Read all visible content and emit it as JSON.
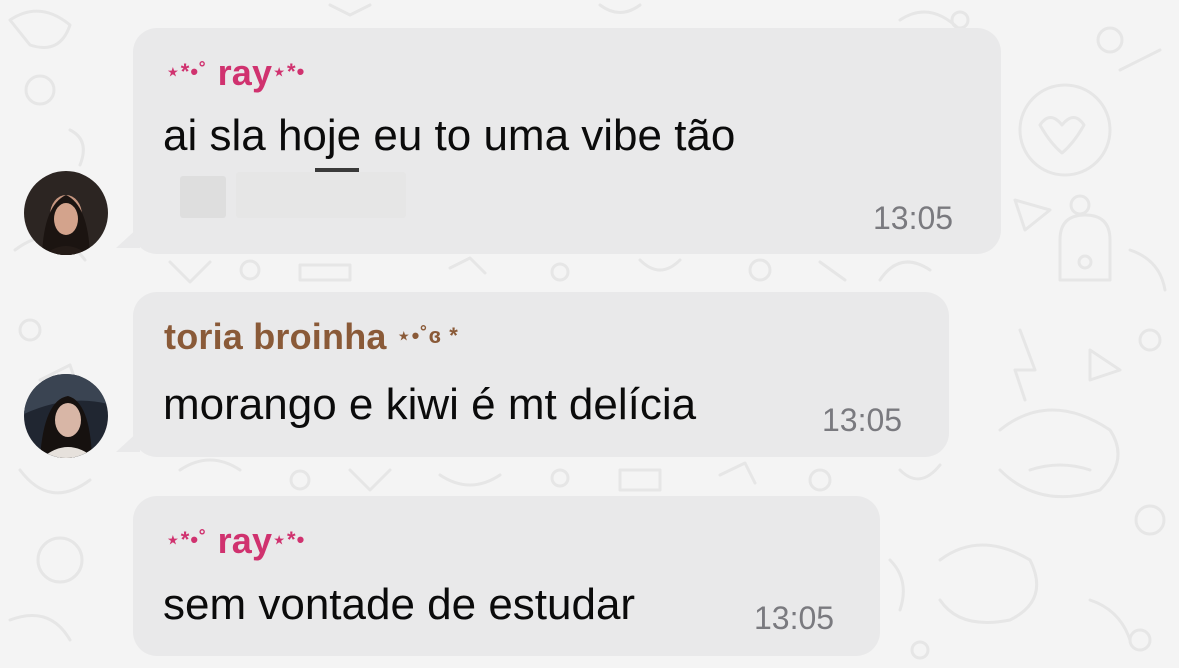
{
  "colors": {
    "background": "#f4f4f4",
    "bubble": "#e9e9ea",
    "sender_ray": "#d0326f",
    "sender_toria": "#8a5a38",
    "message_text": "#0b0b0b",
    "timestamp": "#7a7a7f"
  },
  "messages": [
    {
      "sender_prefix": "⋆*•˚",
      "sender": "ray",
      "sender_suffix": "⋆*•",
      "text": "ai sla hoje eu to uma vibe tão",
      "time": "13:05",
      "avatar_icon": "profile-photo"
    },
    {
      "sender": "toria broinha",
      "sender_suffix": "⋆•˚ɞ *",
      "text": "morango e kiwi é mt delícia",
      "time": "13:05",
      "avatar_icon": "profile-photo"
    },
    {
      "sender_prefix": "⋆*•˚",
      "sender": "ray",
      "sender_suffix": "⋆*•",
      "text": "sem vontade de estudar",
      "time": "13:05"
    }
  ]
}
